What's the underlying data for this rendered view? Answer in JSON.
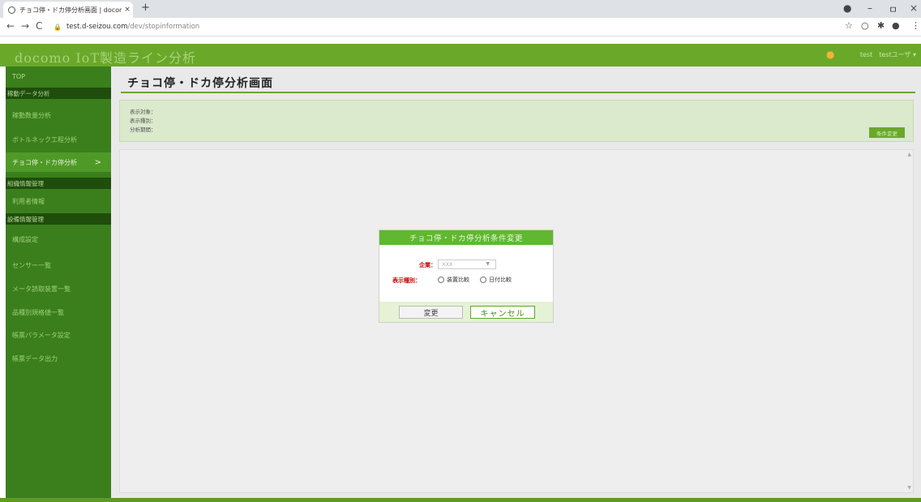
{
  "browser": {
    "tab_title": "チョコ停・ドカ停分析画面 | docomo",
    "tab_close": "×",
    "new_tab": "+",
    "url_host": "test.d-seizou.com",
    "url_path": "/dev/stopinformation",
    "nav": {
      "back": "←",
      "forward": "→",
      "reload": "C"
    },
    "window": {
      "minimize": "–",
      "maximize": "ㅁ",
      "close": "×"
    }
  },
  "header": {
    "title": "docomo IoT製造ライン分析",
    "user": "test　testユーザ ▾"
  },
  "sidebar": {
    "top": "TOP",
    "sections": [
      {
        "label": "稼動データ分析"
      },
      {
        "label": "組織情報管理"
      },
      {
        "label": "設備情報管理"
      }
    ],
    "items": [
      {
        "label": "稼動数量分析"
      },
      {
        "label": "ボトルネック工程分析"
      },
      {
        "label": "チョコ停・ドカ停分析",
        "chevron": ">"
      },
      {
        "label": "利用者情報"
      },
      {
        "label": "構成設定"
      },
      {
        "label": "センサー一覧"
      },
      {
        "label": "メータ読取装置一覧"
      },
      {
        "label": "品種別規格値一覧"
      },
      {
        "label": "帳票パラメータ設定"
      },
      {
        "label": "帳票データ出力"
      }
    ]
  },
  "main": {
    "title": "チョコ停・ドカ停分析画面",
    "info": {
      "target_label": "表示対象：",
      "kind_label": "表示種別：",
      "period_label": "分析期間：",
      "change_button": "条件変更"
    }
  },
  "dialog": {
    "title": "チョコ停・ドカ停分析条件変更",
    "company_label": "企業：",
    "company_value": "XXX",
    "type_label": "表示種別：",
    "radio_device": "装置比較",
    "radio_date": "日付比較",
    "update_button": "変更",
    "cancel_button": "キャンセル"
  }
}
